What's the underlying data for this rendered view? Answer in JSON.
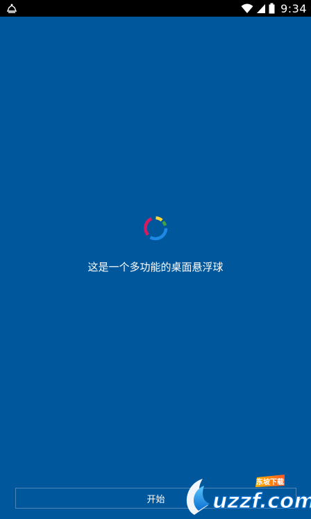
{
  "status_bar": {
    "time": "9:34",
    "icons": [
      "notification-icon",
      "wifi-icon",
      "signal-icon",
      "battery-icon"
    ]
  },
  "main": {
    "tagline": "这是一个多功能的桌面悬浮球"
  },
  "footer": {
    "start_label": "开始"
  },
  "watermark": {
    "text": "uzzf.com",
    "sub": "东坡下载"
  },
  "colors": {
    "background": "#01579b",
    "status_bar": "#000000",
    "ring_red": "#d81b60",
    "ring_yellow": "#fdd835",
    "ring_green": "#43a047",
    "ring_blue": "#1e88e5"
  }
}
